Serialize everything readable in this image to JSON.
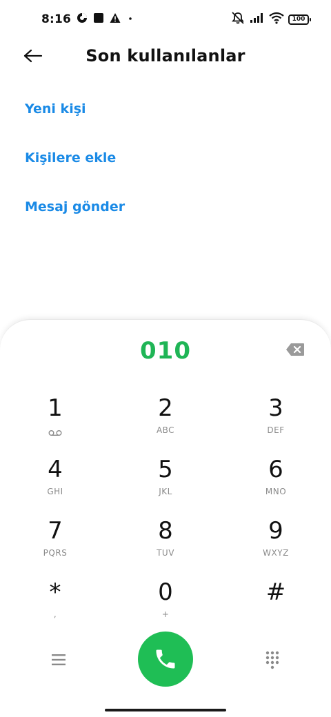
{
  "status_bar": {
    "time": "8:16",
    "battery": "100",
    "icons": [
      "data-saver-icon",
      "notification-square-icon",
      "warning-icon",
      "dot-icon",
      "mute-icon",
      "signal-icon",
      "wifi-icon",
      "battery-icon"
    ]
  },
  "header": {
    "title": "Son kullanılanlar",
    "back_icon": "arrow-left-icon"
  },
  "actions": [
    {
      "label": "Yeni kişi"
    },
    {
      "label": "Kişilere ekle"
    },
    {
      "label": "Mesaj gönder"
    }
  ],
  "dialer": {
    "number": "010",
    "keys": [
      {
        "digit": "1",
        "letters": ""
      },
      {
        "digit": "2",
        "letters": "ABC"
      },
      {
        "digit": "3",
        "letters": "DEF"
      },
      {
        "digit": "4",
        "letters": "GHI"
      },
      {
        "digit": "5",
        "letters": "JKL"
      },
      {
        "digit": "6",
        "letters": "MNO"
      },
      {
        "digit": "7",
        "letters": "PQRS"
      },
      {
        "digit": "8",
        "letters": "TUV"
      },
      {
        "digit": "9",
        "letters": "WXYZ"
      },
      {
        "digit": "*",
        "letters": ","
      },
      {
        "digit": "0",
        "letters": "+"
      },
      {
        "digit": "#",
        "letters": ""
      }
    ]
  },
  "colors": {
    "accent_blue": "#1a8ae6",
    "number_green": "#1fb556",
    "call_green": "#1fbe55"
  }
}
